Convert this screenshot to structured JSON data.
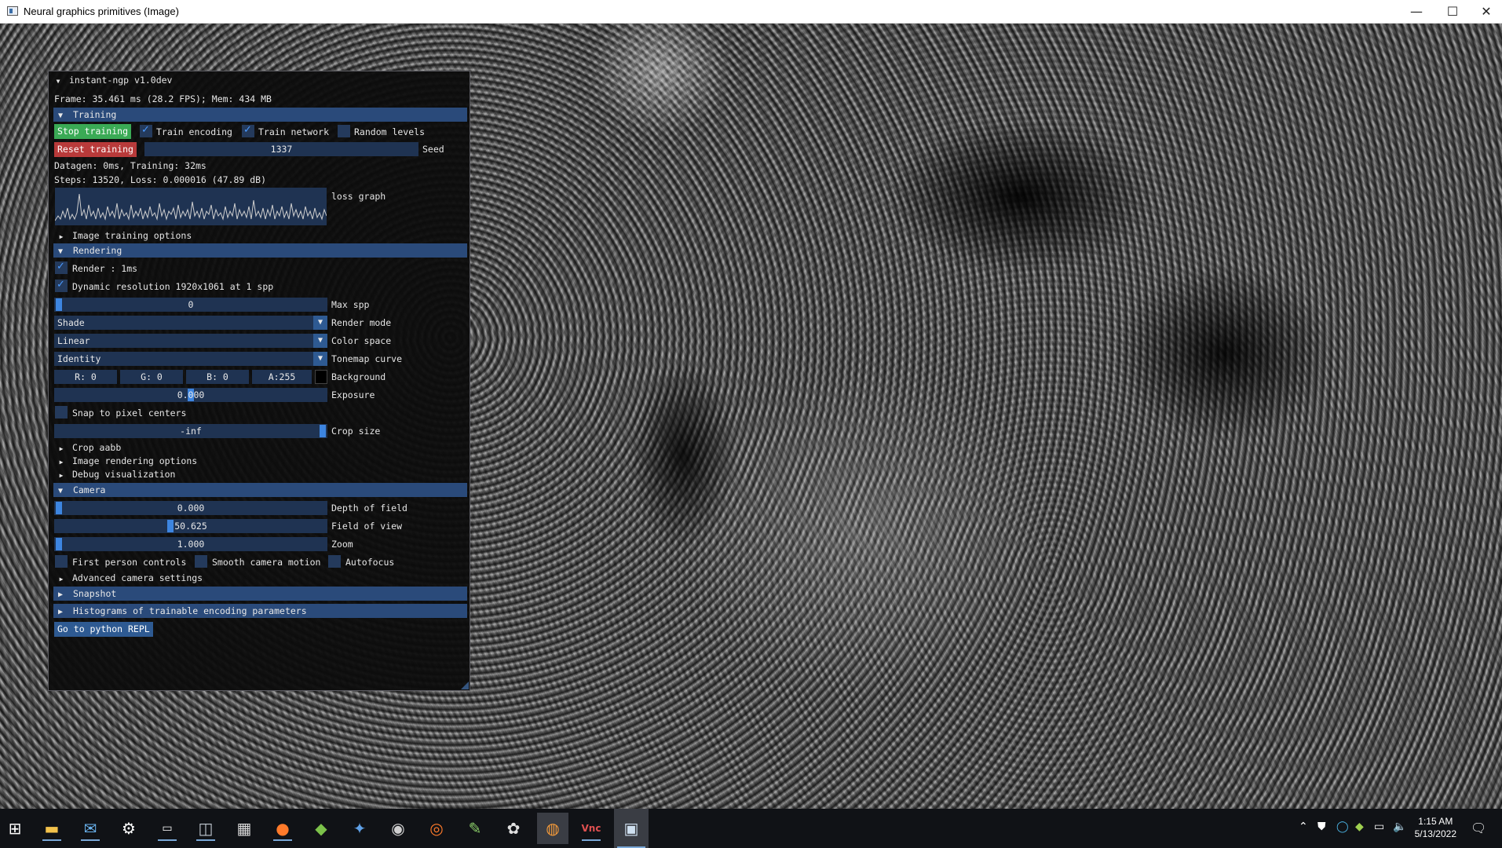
{
  "window": {
    "title": "Neural graphics primitives (Image)",
    "controls": {
      "minimize": "—",
      "maximize": "☐",
      "close": "✕"
    }
  },
  "panel": {
    "title": "instant-ngp v1.0dev",
    "frame_info": "Frame: 35.461 ms (28.2 FPS); Mem: 434 MB",
    "training": {
      "header": "Training",
      "stop_button": "Stop training",
      "train_encoding": {
        "label": "Train encoding",
        "checked": true
      },
      "train_network": {
        "label": "Train network",
        "checked": true
      },
      "random_levels": {
        "label": "Random levels",
        "checked": false
      },
      "reset_button": "Reset training",
      "seed_value": "1337",
      "seed_label": "Seed",
      "datagen": "Datagen: 0ms, Training: 32ms",
      "steps": "Steps: 13520, Loss: 0.000016 (47.89 dB)",
      "loss_graph_label": "loss graph",
      "image_training_options": "Image training options"
    },
    "rendering": {
      "header": "Rendering",
      "render": {
        "label": "Render : 1ms",
        "checked": true
      },
      "dynamic_resolution": {
        "label": "Dynamic resolution 1920x1061 at 1 spp",
        "checked": true
      },
      "max_spp": {
        "value": "0",
        "label": "Max spp",
        "fraction": 0.0
      },
      "render_mode": {
        "value": "Shade",
        "label": "Render mode"
      },
      "color_space": {
        "value": "Linear",
        "label": "Color space"
      },
      "tonemap_curve": {
        "value": "Identity",
        "label": "Tonemap curve"
      },
      "background": {
        "r": "R:  0",
        "g": "G:  0",
        "b": "B:  0",
        "a": "A:255",
        "label": "Background",
        "color": "#000000"
      },
      "exposure": {
        "value": "0.000",
        "label": "Exposure",
        "fraction": 0.5
      },
      "snap": {
        "label": "Snap to pixel centers",
        "checked": false
      },
      "crop_size": {
        "value": "-inf",
        "label": "Crop size",
        "fraction": 1.0
      },
      "crop_aabb": "Crop aabb",
      "image_rendering_options": "Image rendering options",
      "debug_visualization": "Debug visualization"
    },
    "camera": {
      "header": "Camera",
      "depth_of_field": {
        "value": "0.000",
        "label": "Depth of field",
        "fraction": 0.0
      },
      "field_of_view": {
        "value": "50.625",
        "label": "Field of view",
        "fraction": 0.42
      },
      "zoom": {
        "value": "1.000",
        "label": "Zoom",
        "fraction": 0.0
      },
      "first_person": {
        "label": "First person controls",
        "checked": false
      },
      "smooth_motion": {
        "label": "Smooth camera motion",
        "checked": false
      },
      "autofocus": {
        "label": "Autofocus",
        "checked": false
      },
      "advanced": "Advanced camera settings"
    },
    "snapshot_header": "Snapshot",
    "histograms_header": "Histograms of trainable encoding parameters",
    "python_repl_button": "Go to python REPL"
  },
  "taskbar": {
    "icons": [
      "windows-start-icon",
      "file-explorer-icon",
      "mail-icon",
      "settings-icon",
      "terminal-icon",
      "disk-utility-icon",
      "calculator-icon",
      "firefox-icon",
      "nvidia-icon",
      "davinci-resolve-icon",
      "obs-icon",
      "houdini-icon",
      "notepad-icon",
      "paint-icon",
      "blender-icon",
      "vnc-viewer-icon",
      "instant-ngp-icon"
    ],
    "time": "1:15 AM",
    "date": "5/13/2022"
  },
  "colors": {
    "header_bg": "#2a4a7a",
    "field_bg": "#1f3352",
    "stop_training": "#3aaa55",
    "reset_training": "#b83a3a",
    "accent": "#3d85e0"
  }
}
